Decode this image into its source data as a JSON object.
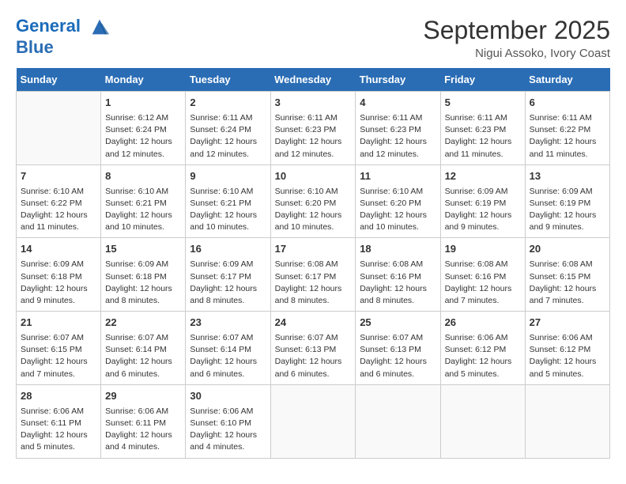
{
  "header": {
    "logo_line1": "General",
    "logo_line2": "Blue",
    "month": "September 2025",
    "location": "Nigui Assoko, Ivory Coast"
  },
  "weekdays": [
    "Sunday",
    "Monday",
    "Tuesday",
    "Wednesday",
    "Thursday",
    "Friday",
    "Saturday"
  ],
  "weeks": [
    [
      {
        "day": "",
        "info": ""
      },
      {
        "day": "1",
        "info": "Sunrise: 6:12 AM\nSunset: 6:24 PM\nDaylight: 12 hours\nand 12 minutes."
      },
      {
        "day": "2",
        "info": "Sunrise: 6:11 AM\nSunset: 6:24 PM\nDaylight: 12 hours\nand 12 minutes."
      },
      {
        "day": "3",
        "info": "Sunrise: 6:11 AM\nSunset: 6:23 PM\nDaylight: 12 hours\nand 12 minutes."
      },
      {
        "day": "4",
        "info": "Sunrise: 6:11 AM\nSunset: 6:23 PM\nDaylight: 12 hours\nand 12 minutes."
      },
      {
        "day": "5",
        "info": "Sunrise: 6:11 AM\nSunset: 6:23 PM\nDaylight: 12 hours\nand 11 minutes."
      },
      {
        "day": "6",
        "info": "Sunrise: 6:11 AM\nSunset: 6:22 PM\nDaylight: 12 hours\nand 11 minutes."
      }
    ],
    [
      {
        "day": "7",
        "info": "Sunrise: 6:10 AM\nSunset: 6:22 PM\nDaylight: 12 hours\nand 11 minutes."
      },
      {
        "day": "8",
        "info": "Sunrise: 6:10 AM\nSunset: 6:21 PM\nDaylight: 12 hours\nand 10 minutes."
      },
      {
        "day": "9",
        "info": "Sunrise: 6:10 AM\nSunset: 6:21 PM\nDaylight: 12 hours\nand 10 minutes."
      },
      {
        "day": "10",
        "info": "Sunrise: 6:10 AM\nSunset: 6:20 PM\nDaylight: 12 hours\nand 10 minutes."
      },
      {
        "day": "11",
        "info": "Sunrise: 6:10 AM\nSunset: 6:20 PM\nDaylight: 12 hours\nand 10 minutes."
      },
      {
        "day": "12",
        "info": "Sunrise: 6:09 AM\nSunset: 6:19 PM\nDaylight: 12 hours\nand 9 minutes."
      },
      {
        "day": "13",
        "info": "Sunrise: 6:09 AM\nSunset: 6:19 PM\nDaylight: 12 hours\nand 9 minutes."
      }
    ],
    [
      {
        "day": "14",
        "info": "Sunrise: 6:09 AM\nSunset: 6:18 PM\nDaylight: 12 hours\nand 9 minutes."
      },
      {
        "day": "15",
        "info": "Sunrise: 6:09 AM\nSunset: 6:18 PM\nDaylight: 12 hours\nand 8 minutes."
      },
      {
        "day": "16",
        "info": "Sunrise: 6:09 AM\nSunset: 6:17 PM\nDaylight: 12 hours\nand 8 minutes."
      },
      {
        "day": "17",
        "info": "Sunrise: 6:08 AM\nSunset: 6:17 PM\nDaylight: 12 hours\nand 8 minutes."
      },
      {
        "day": "18",
        "info": "Sunrise: 6:08 AM\nSunset: 6:16 PM\nDaylight: 12 hours\nand 8 minutes."
      },
      {
        "day": "19",
        "info": "Sunrise: 6:08 AM\nSunset: 6:16 PM\nDaylight: 12 hours\nand 7 minutes."
      },
      {
        "day": "20",
        "info": "Sunrise: 6:08 AM\nSunset: 6:15 PM\nDaylight: 12 hours\nand 7 minutes."
      }
    ],
    [
      {
        "day": "21",
        "info": "Sunrise: 6:07 AM\nSunset: 6:15 PM\nDaylight: 12 hours\nand 7 minutes."
      },
      {
        "day": "22",
        "info": "Sunrise: 6:07 AM\nSunset: 6:14 PM\nDaylight: 12 hours\nand 6 minutes."
      },
      {
        "day": "23",
        "info": "Sunrise: 6:07 AM\nSunset: 6:14 PM\nDaylight: 12 hours\nand 6 minutes."
      },
      {
        "day": "24",
        "info": "Sunrise: 6:07 AM\nSunset: 6:13 PM\nDaylight: 12 hours\nand 6 minutes."
      },
      {
        "day": "25",
        "info": "Sunrise: 6:07 AM\nSunset: 6:13 PM\nDaylight: 12 hours\nand 6 minutes."
      },
      {
        "day": "26",
        "info": "Sunrise: 6:06 AM\nSunset: 6:12 PM\nDaylight: 12 hours\nand 5 minutes."
      },
      {
        "day": "27",
        "info": "Sunrise: 6:06 AM\nSunset: 6:12 PM\nDaylight: 12 hours\nand 5 minutes."
      }
    ],
    [
      {
        "day": "28",
        "info": "Sunrise: 6:06 AM\nSunset: 6:11 PM\nDaylight: 12 hours\nand 5 minutes."
      },
      {
        "day": "29",
        "info": "Sunrise: 6:06 AM\nSunset: 6:11 PM\nDaylight: 12 hours\nand 4 minutes."
      },
      {
        "day": "30",
        "info": "Sunrise: 6:06 AM\nSunset: 6:10 PM\nDaylight: 12 hours\nand 4 minutes."
      },
      {
        "day": "",
        "info": ""
      },
      {
        "day": "",
        "info": ""
      },
      {
        "day": "",
        "info": ""
      },
      {
        "day": "",
        "info": ""
      }
    ]
  ]
}
